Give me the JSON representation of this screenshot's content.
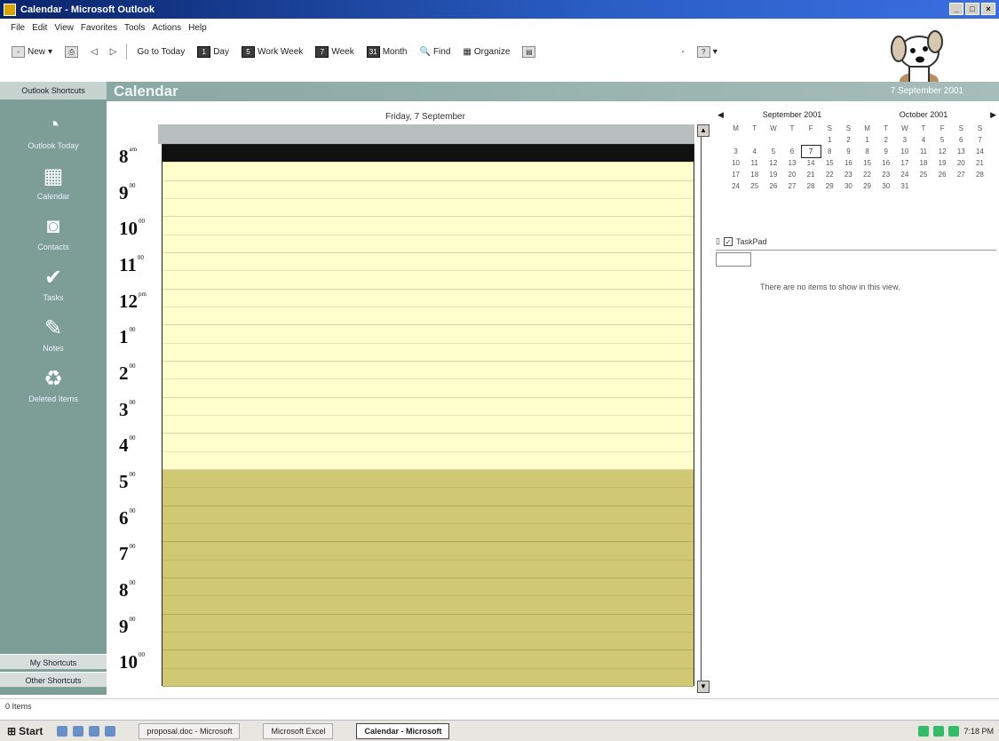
{
  "window": {
    "title": "Calendar - Microsoft Outlook",
    "buttons": [
      "_",
      "□",
      "×"
    ]
  },
  "menu": [
    "File",
    "Edit",
    "View",
    "Favorites",
    "Tools",
    "Actions",
    "Help"
  ],
  "toolbar": {
    "new_label": "New",
    "go_to_today": "Go to Today",
    "day": "Day",
    "work_week": "Work Week",
    "week": "Week",
    "month": "Month",
    "find": "Find",
    "organize": "Organize",
    "day_icon": "1",
    "work_week_icon": "5",
    "week_icon": "7",
    "month_icon": "31"
  },
  "outlook_bar": {
    "group_header": "Outlook Shortcuts",
    "shortcuts": [
      {
        "label": "Outlook Today",
        "icon": "outlook-today-icon"
      },
      {
        "label": "Calendar",
        "icon": "calendar-icon"
      },
      {
        "label": "Contacts",
        "icon": "contacts-icon"
      },
      {
        "label": "Tasks",
        "icon": "tasks-icon"
      },
      {
        "label": "Notes",
        "icon": "notes-icon"
      },
      {
        "label": "Deleted Items",
        "icon": "deleted-items-icon"
      }
    ],
    "my_shortcuts": "My Shortcuts",
    "other_shortcuts": "Other Shortcuts"
  },
  "banner": {
    "title": "Calendar",
    "date": "7 September 2001"
  },
  "day_view": {
    "header": "Friday, 7 September",
    "times": [
      {
        "h": "8",
        "m": "am"
      },
      {
        "h": "9",
        "m": "00"
      },
      {
        "h": "10",
        "m": "00"
      },
      {
        "h": "11",
        "m": "00"
      },
      {
        "h": "12",
        "m": "pm"
      },
      {
        "h": "1",
        "m": "00"
      },
      {
        "h": "2",
        "m": "00"
      },
      {
        "h": "3",
        "m": "00"
      },
      {
        "h": "4",
        "m": "00"
      },
      {
        "h": "5",
        "m": "00"
      },
      {
        "h": "6",
        "m": "00"
      },
      {
        "h": "7",
        "m": "00"
      },
      {
        "h": "8",
        "m": "00"
      },
      {
        "h": "9",
        "m": "00"
      },
      {
        "h": "10",
        "m": "00"
      }
    ],
    "slots_per_hour": 2,
    "working_hours_end_index": 9
  },
  "navigator": {
    "months": [
      {
        "name": "September 2001",
        "days": [
          "M",
          "T",
          "W",
          "T",
          "F",
          "S",
          "S"
        ],
        "weeks": [
          [
            "",
            "",
            "",
            "",
            "",
            "1",
            "2"
          ],
          [
            "3",
            "4",
            "5",
            "6",
            "7",
            "8",
            "9"
          ],
          [
            "10",
            "11",
            "12",
            "13",
            "14",
            "15",
            "16"
          ],
          [
            "17",
            "18",
            "19",
            "20",
            "21",
            "22",
            "23"
          ],
          [
            "24",
            "25",
            "26",
            "27",
            "28",
            "29",
            "30"
          ]
        ]
      },
      {
        "name": "October 2001",
        "days": [
          "M",
          "T",
          "W",
          "T",
          "F",
          "S",
          "S"
        ],
        "weeks": [
          [
            "1",
            "2",
            "3",
            "4",
            "5",
            "6",
            "7"
          ],
          [
            "8",
            "9",
            "10",
            "11",
            "12",
            "13",
            "14"
          ],
          [
            "15",
            "16",
            "17",
            "18",
            "19",
            "20",
            "21"
          ],
          [
            "22",
            "23",
            "24",
            "25",
            "26",
            "27",
            "28"
          ],
          [
            "29",
            "30",
            "31",
            "",
            "",
            "",
            ""
          ]
        ]
      }
    ],
    "today": "7"
  },
  "taskpad": {
    "header": "TaskPad",
    "empty_message": "There are no items to show in this view."
  },
  "status": {
    "text": "0 Items"
  },
  "taskbar": {
    "start": "Start",
    "items": [
      "proposal.doc - Microsoft",
      "Microsoft Excel",
      "Calendar - Microsoft"
    ],
    "clock": "7:18 PM"
  }
}
